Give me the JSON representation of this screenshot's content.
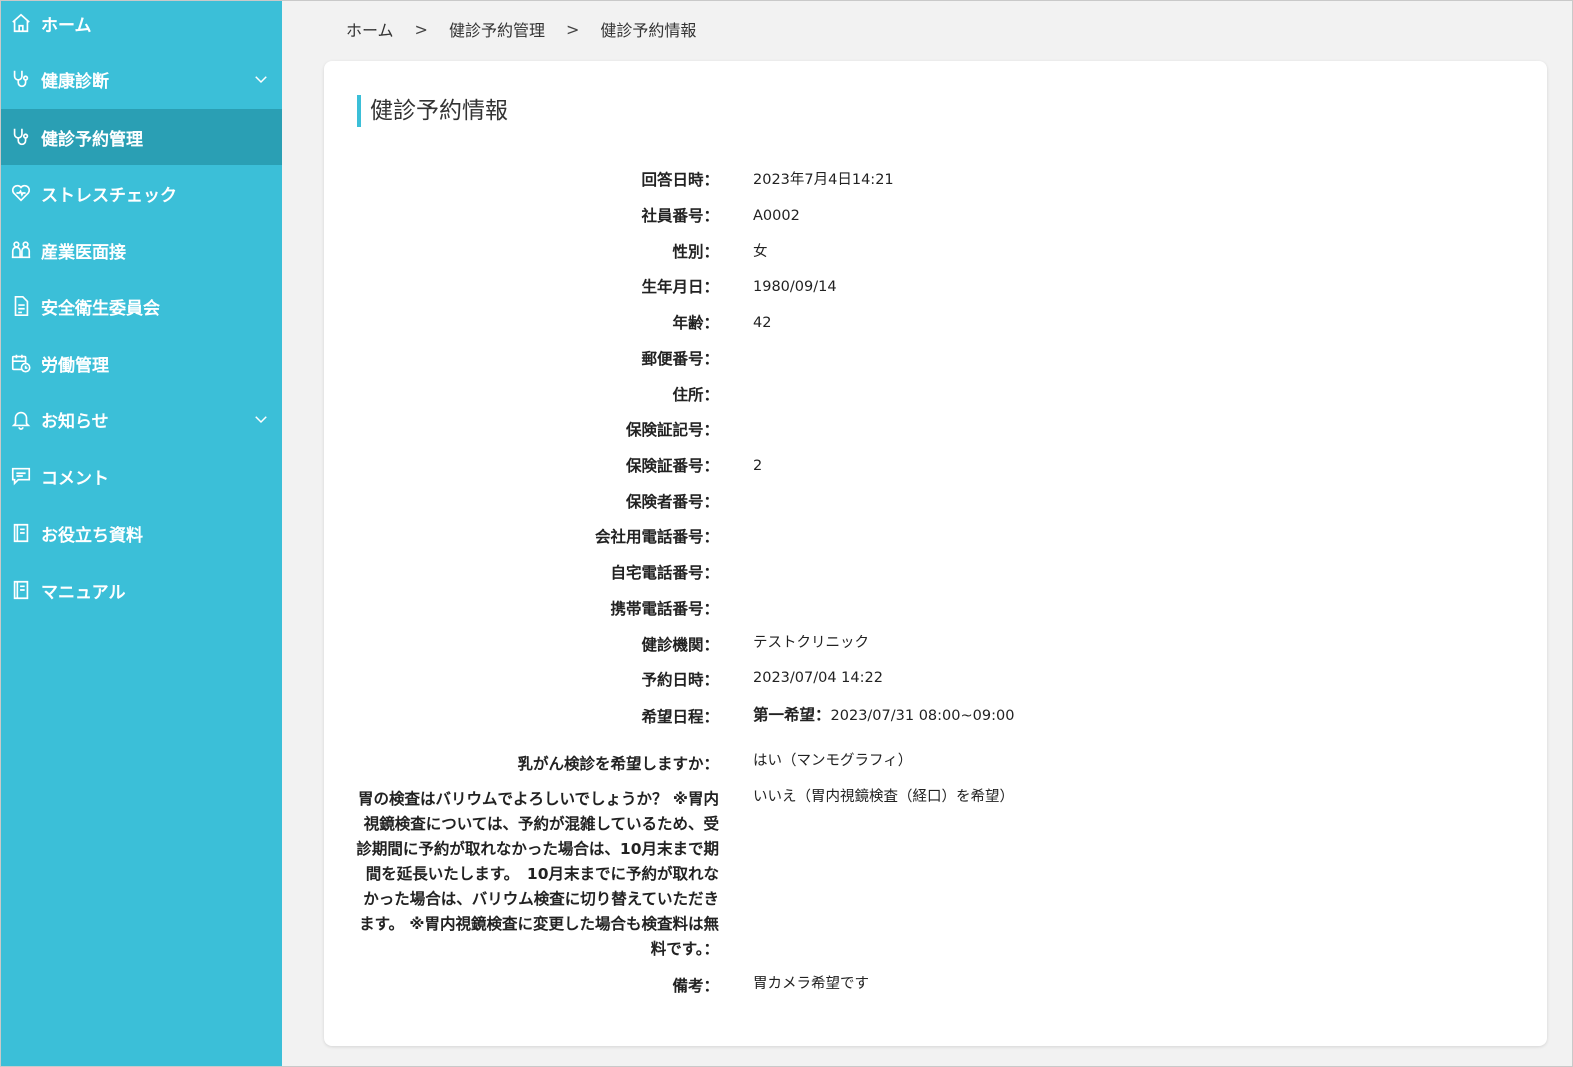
{
  "sidebar": {
    "items": [
      {
        "label": "ホーム",
        "icon": "home-icon"
      },
      {
        "label": "健康診断",
        "icon": "stethoscope-icon",
        "expandable": true
      },
      {
        "label": "健診予約管理",
        "icon": "stethoscope-icon",
        "active": true
      },
      {
        "label": "ストレスチェック",
        "icon": "heart-icon"
      },
      {
        "label": "産業医面接",
        "icon": "people-icon"
      },
      {
        "label": "安全衛生委員会",
        "icon": "document-icon"
      },
      {
        "label": "労働管理",
        "icon": "calendar-clock-icon"
      },
      {
        "label": "お知らせ",
        "icon": "bell-icon",
        "expandable": true
      },
      {
        "label": "コメント",
        "icon": "comment-icon"
      },
      {
        "label": "お役立ち資料",
        "icon": "book-icon"
      },
      {
        "label": "マニュアル",
        "icon": "book-icon"
      }
    ],
    "background_color": "#3bbfd8",
    "active_color": "#2a9fb4"
  },
  "breadcrumb": {
    "items": [
      "ホーム",
      "健診予約管理",
      "健診予約情報"
    ],
    "separator": ">"
  },
  "page": {
    "title": "健診予約情報",
    "accent_color": "#3bbfd8"
  },
  "details": [
    {
      "label": "回答日時：",
      "value": "2023年7月4日14:21"
    },
    {
      "label": "社員番号：",
      "value": "A0002"
    },
    {
      "label": "性別：",
      "value": "女"
    },
    {
      "label": "生年月日：",
      "value": "1980/09/14"
    },
    {
      "label": "年齢：",
      "value": "42"
    },
    {
      "label": "郵便番号：",
      "value": ""
    },
    {
      "label": "住所：",
      "value": ""
    },
    {
      "label": "保険証記号：",
      "value": ""
    },
    {
      "label": "保険証番号：",
      "value": "2"
    },
    {
      "label": "保険者番号：",
      "value": ""
    },
    {
      "label": "会社用電話番号：",
      "value": ""
    },
    {
      "label": "自宅電話番号：",
      "value": ""
    },
    {
      "label": "携帯電話番号：",
      "value": ""
    },
    {
      "label": "健診機関：",
      "value": "テストクリニック"
    },
    {
      "label": "予約日時：",
      "value": "2023/07/04 14:22"
    },
    {
      "label": "希望日程：",
      "value_label": "第一希望：",
      "value": "2023/07/31 08:00~09:00"
    },
    {
      "label": "乳がん検診を希望しますか：",
      "value": "はい（マンモグラフィ）"
    },
    {
      "label": "胃の検査はバリウムでよろしいでしょうか？ ※胃内視鏡検査については、予約が混雑しているため、受診期間に予約が取れなかった場合は、10月末まで期間を延長いたします。　10月末までに予約が取れなかった場合は、バリウム検査に切り替えていただきます。 ※胃内視鏡検査に変更した場合も検査料は無料です。：",
      "value": "いいえ（胃内視鏡検査（経口）を希望）"
    },
    {
      "label": "備考：",
      "value": "胃カメラ希望です"
    }
  ]
}
